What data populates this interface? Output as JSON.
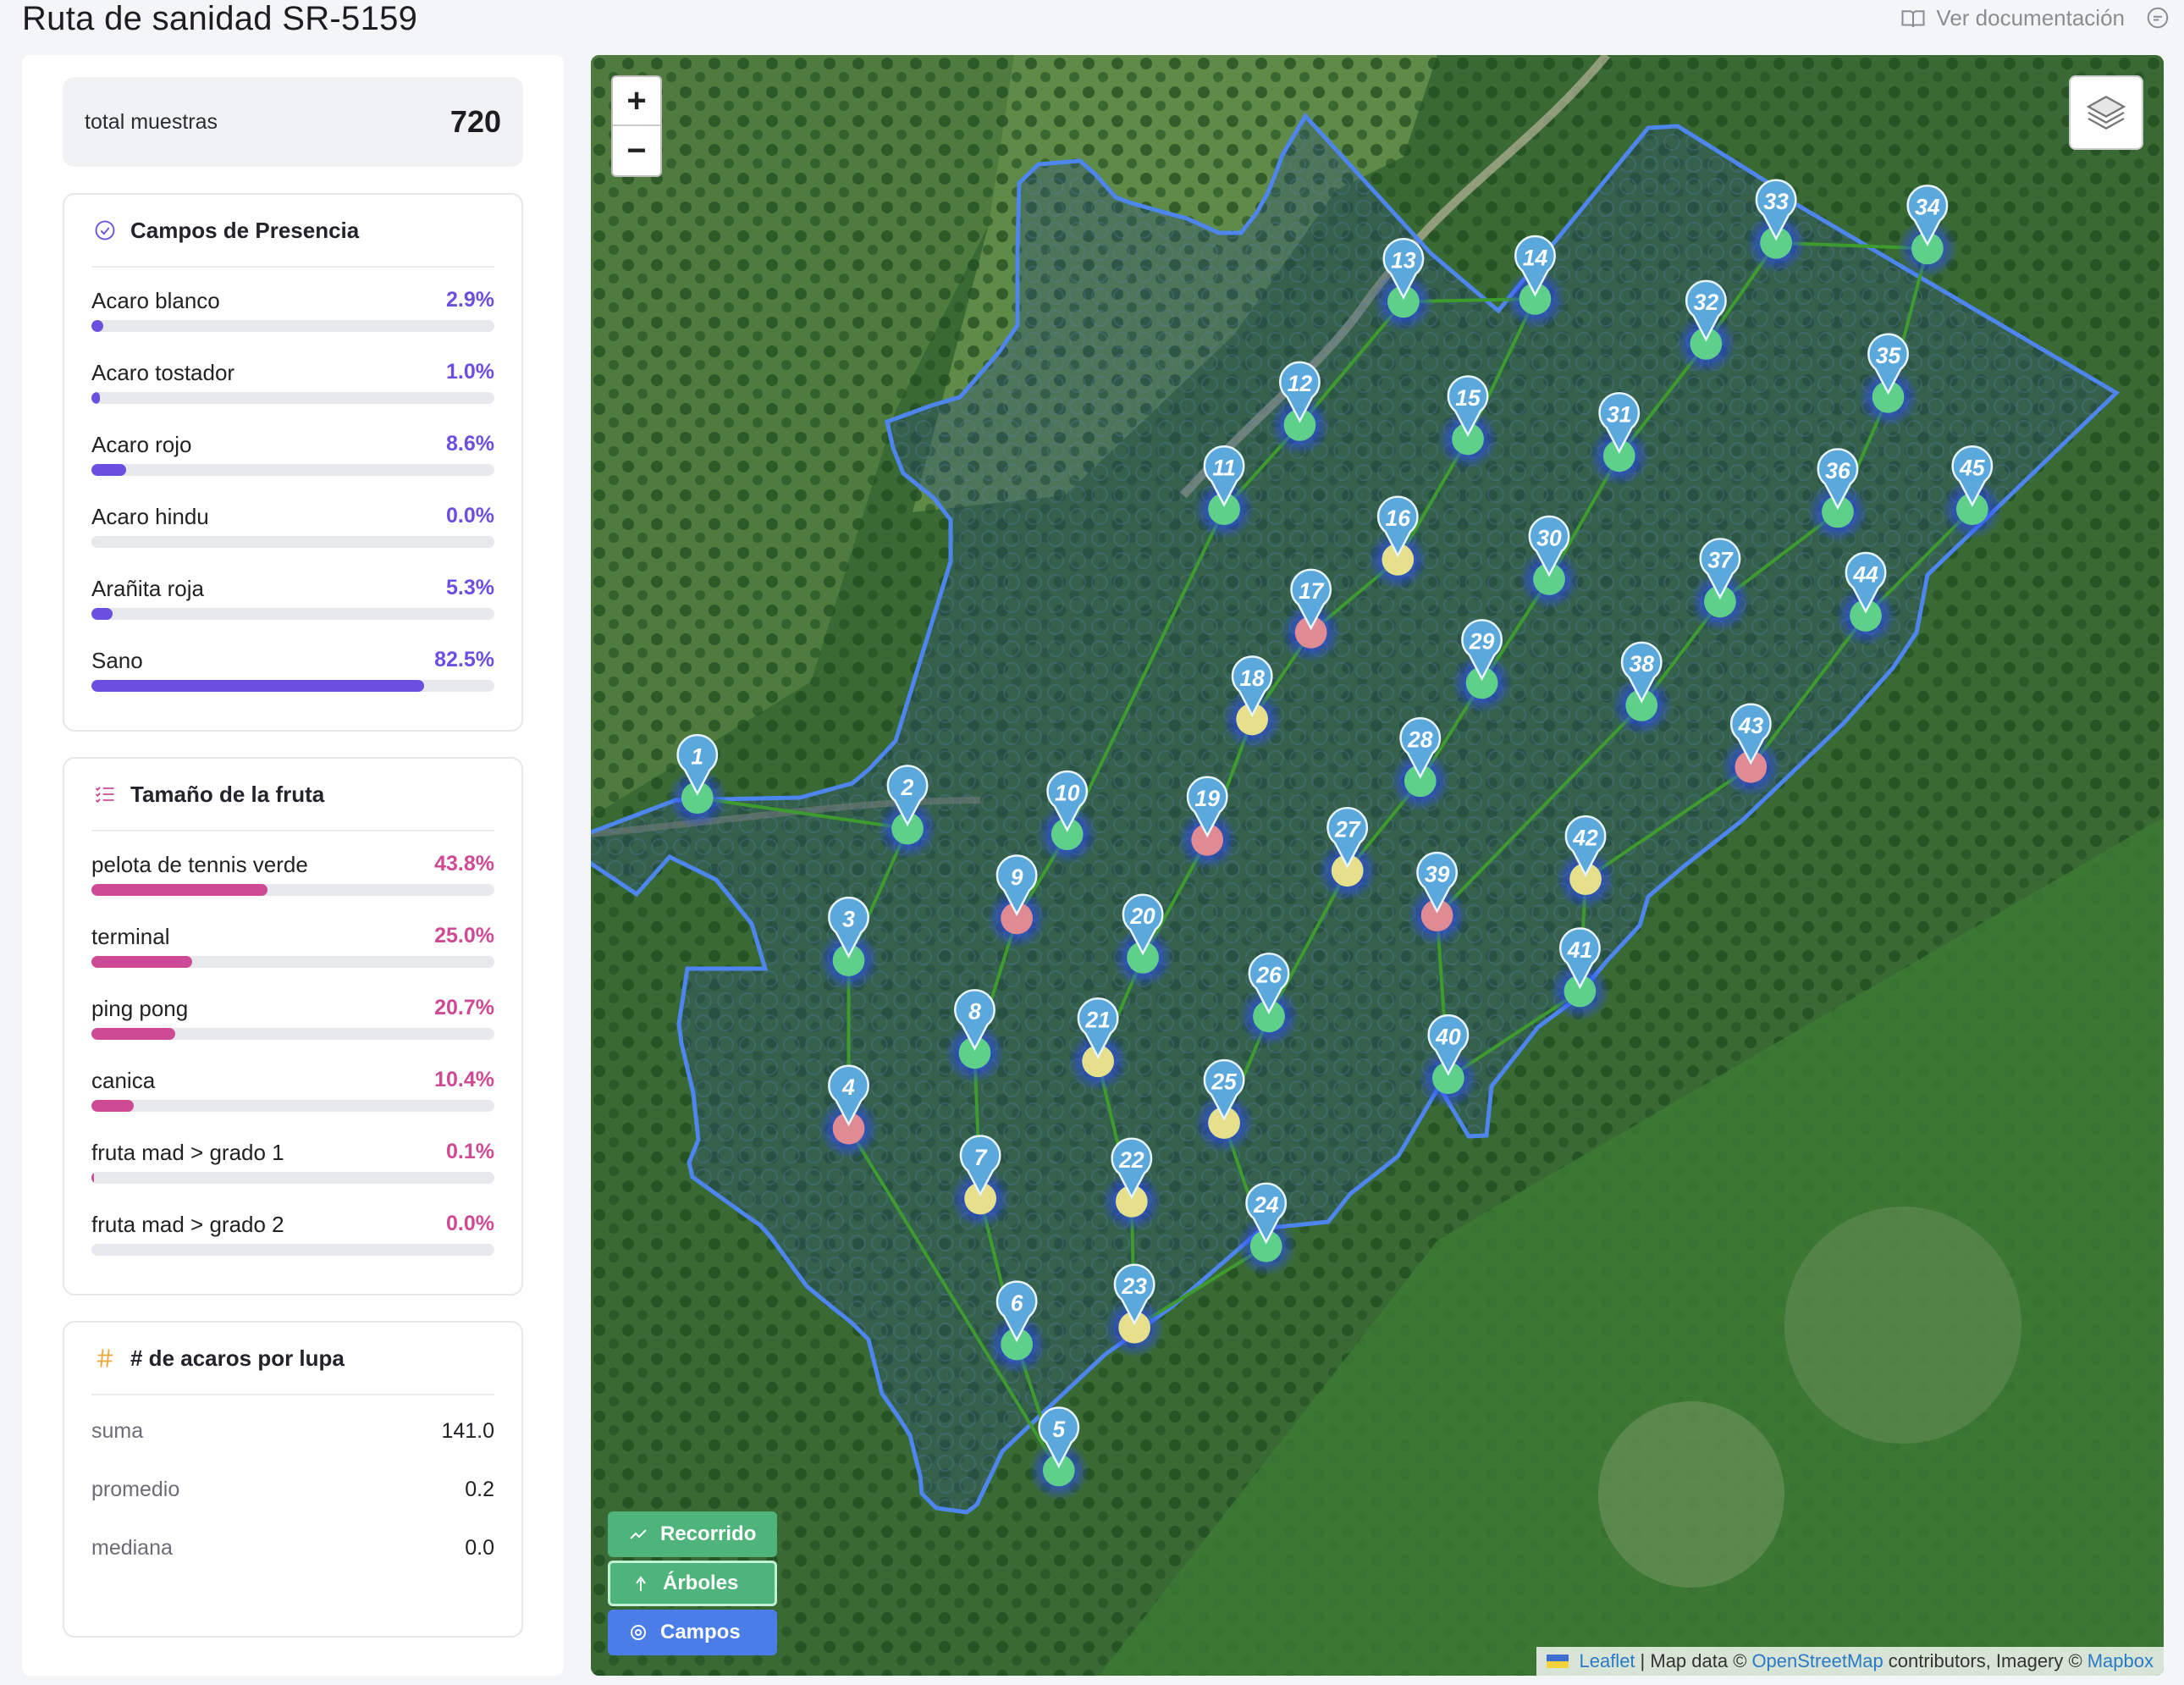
{
  "header": {
    "title": "Ruta de sanidad SR-5159",
    "doc_link": "Ver documentación"
  },
  "sidebar": {
    "total": {
      "label": "total muestras",
      "value": "720"
    },
    "presence": {
      "title": "Campos de Presencia",
      "color": "#6b4fe0",
      "items": [
        {
          "label": "Acaro blanco",
          "pct": "2.9%",
          "value": 2.9
        },
        {
          "label": "Acaro tostador",
          "pct": "1.0%",
          "value": 1.0
        },
        {
          "label": "Acaro rojo",
          "pct": "8.6%",
          "value": 8.6
        },
        {
          "label": "Acaro hindu",
          "pct": "0.0%",
          "value": 0.0
        },
        {
          "label": "Arañita roja",
          "pct": "5.3%",
          "value": 5.3
        },
        {
          "label": "Sano",
          "pct": "82.5%",
          "value": 82.5
        }
      ]
    },
    "fruit": {
      "title": "Tamaño de la fruta",
      "color": "#cf4a94",
      "items": [
        {
          "label": "pelota de tennis verde",
          "pct": "43.8%",
          "value": 43.8
        },
        {
          "label": "terminal",
          "pct": "25.0%",
          "value": 25.0
        },
        {
          "label": "ping pong",
          "pct": "20.7%",
          "value": 20.7
        },
        {
          "label": "canica",
          "pct": "10.4%",
          "value": 10.4
        },
        {
          "label": "fruta mad > grado 1",
          "pct": "0.1%",
          "value": 0.1
        },
        {
          "label": "fruta mad > grado 2",
          "pct": "0.0%",
          "value": 0.0
        }
      ]
    },
    "mites": {
      "title": "# de acaros por lupa",
      "icon_color": "#e8a83a",
      "stats": [
        {
          "label": "suma",
          "value": "141.0"
        },
        {
          "label": "promedio",
          "value": "0.2"
        },
        {
          "label": "mediana",
          "value": "0.0"
        }
      ]
    }
  },
  "map": {
    "zoom_in": "+",
    "zoom_out": "−",
    "buttons": {
      "route": "Recorrido",
      "trees": "Árboles",
      "fields": "Campos"
    },
    "attribution": {
      "leaflet": "Leaflet",
      "sep": "| Map data ©",
      "osm": "OpenStreetMap",
      "rest": "contributors, Imagery ©",
      "mapbox": "Mapbox"
    },
    "route_order": [
      1,
      2,
      3,
      4,
      5,
      6,
      7,
      8,
      9,
      10,
      11,
      12,
      13,
      14,
      15,
      16,
      17,
      18,
      19,
      20,
      21,
      22,
      23,
      24,
      25,
      26,
      27,
      28,
      29,
      30,
      31,
      32,
      33,
      34,
      35,
      36,
      37,
      38,
      39,
      40,
      41,
      42,
      43,
      44,
      45
    ],
    "samples": [
      {
        "id": "1",
        "status": "sano"
      },
      {
        "id": "2",
        "status": "sano"
      },
      {
        "id": "3",
        "status": "sano"
      },
      {
        "id": "4",
        "status": "acaro"
      },
      {
        "id": "5",
        "status": "sano"
      },
      {
        "id": "6",
        "status": "sano"
      },
      {
        "id": "7",
        "status": "leve"
      },
      {
        "id": "8",
        "status": "sano"
      },
      {
        "id": "9",
        "status": "acaro"
      },
      {
        "id": "10",
        "status": "sano"
      },
      {
        "id": "11",
        "status": "sano"
      },
      {
        "id": "12",
        "status": "sano"
      },
      {
        "id": "13",
        "status": "sano"
      },
      {
        "id": "14",
        "status": "sano"
      },
      {
        "id": "15",
        "status": "sano"
      },
      {
        "id": "16",
        "status": "leve"
      },
      {
        "id": "17",
        "status": "acaro"
      },
      {
        "id": "18",
        "status": "leve"
      },
      {
        "id": "19",
        "status": "acaro"
      },
      {
        "id": "20",
        "status": "sano"
      },
      {
        "id": "21",
        "status": "leve"
      },
      {
        "id": "22",
        "status": "leve"
      },
      {
        "id": "23",
        "status": "leve"
      },
      {
        "id": "24",
        "status": "sano"
      },
      {
        "id": "25",
        "status": "leve"
      },
      {
        "id": "26",
        "status": "sano"
      },
      {
        "id": "27",
        "status": "leve"
      },
      {
        "id": "28",
        "status": "sano"
      },
      {
        "id": "29",
        "status": "sano"
      },
      {
        "id": "30",
        "status": "sano"
      },
      {
        "id": "31",
        "status": "sano"
      },
      {
        "id": "32",
        "status": "sano"
      },
      {
        "id": "33",
        "status": "sano"
      },
      {
        "id": "34",
        "status": "sano"
      },
      {
        "id": "35",
        "status": "sano"
      },
      {
        "id": "36",
        "status": "sano"
      },
      {
        "id": "37",
        "status": "sano"
      },
      {
        "id": "38",
        "status": "sano"
      },
      {
        "id": "39",
        "status": "acaro"
      },
      {
        "id": "40",
        "status": "sano"
      },
      {
        "id": "41",
        "status": "sano"
      },
      {
        "id": "42",
        "status": "leve"
      },
      {
        "id": "43",
        "status": "acaro"
      },
      {
        "id": "44",
        "status": "sano"
      },
      {
        "id": "45",
        "status": "sano"
      }
    ],
    "colors": {
      "field": "#4d86f0",
      "route": "#3e9b2e",
      "pin": "#5aa8dc",
      "glow": "#1e3cff",
      "sano": "#5fd08a",
      "leve": "#e6e08c",
      "acaro": "#e08a93"
    }
  }
}
